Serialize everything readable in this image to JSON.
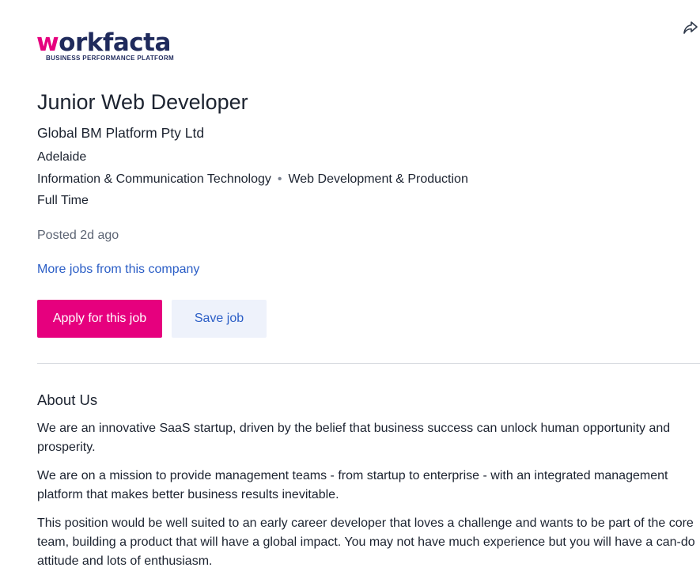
{
  "brand": {
    "logo_w": "w",
    "logo_rest": "orkfacta",
    "tagline": "BUSINESS PERFORMANCE PLATFORM",
    "primary_color": "#e6007e",
    "navy_color": "#1f2a5c"
  },
  "share_icon": "share-arrow-icon",
  "job": {
    "title": "Junior Web Developer",
    "company": "Global BM Platform Pty Ltd",
    "location": "Adelaide",
    "category": "Information & Communication Technology",
    "category_separator": "•",
    "subcategory": "Web Development & Production",
    "work_type": "Full Time",
    "posted": "Posted 2d ago",
    "more_jobs_link": "More jobs from this company"
  },
  "actions": {
    "apply_label": "Apply for this job",
    "save_label": "Save job"
  },
  "about": {
    "heading": "About Us",
    "paragraphs": [
      "We are an innovative SaaS startup, driven by the belief that business success can unlock human opportunity and prosperity.",
      "We are on a mission to provide management teams  - from startup to enterprise - with an integrated management platform that makes better business results inevitable.",
      "This position would be well suited to an early career developer that loves a challenge and wants to be part of the core team, building a product that will have a global impact. You may not have much experience but you will have a can-do attitude and lots of enthusiasm."
    ]
  }
}
